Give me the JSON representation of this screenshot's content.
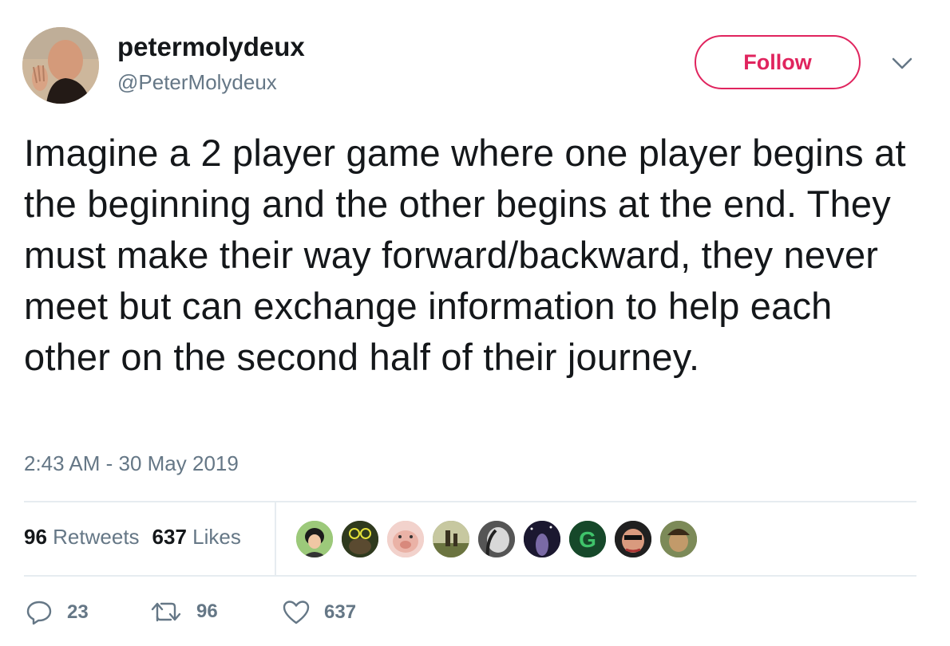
{
  "user": {
    "display_name": "petermolydeux",
    "handle": "@PeterMolydeux",
    "avatar_icon": "profile-photo"
  },
  "header": {
    "follow_label": "Follow",
    "more_icon": "chevron-down-icon"
  },
  "tweet": {
    "text": "Imagine a 2 player game where one player begins at the beginning and the other begins at the end. They must make their way forward/backward, they never meet but can exchange information to help each other on the second half of their journey.",
    "timestamp": "2:43 AM - 30 May 2019"
  },
  "stats": {
    "retweets_count": "96",
    "retweets_label": "Retweets",
    "likes_count": "637",
    "likes_label": "Likes"
  },
  "likers": [
    "liker-avatar-1",
    "liker-avatar-2",
    "liker-avatar-3",
    "liker-avatar-4",
    "liker-avatar-5",
    "liker-avatar-6",
    "liker-avatar-7",
    "liker-avatar-8",
    "liker-avatar-9"
  ],
  "actions": {
    "reply_count": "23",
    "retweet_count": "96",
    "like_count": "637"
  },
  "colors": {
    "follow_accent": "#e0245e",
    "secondary_text": "#657786",
    "divider": "#e6ecf0"
  }
}
